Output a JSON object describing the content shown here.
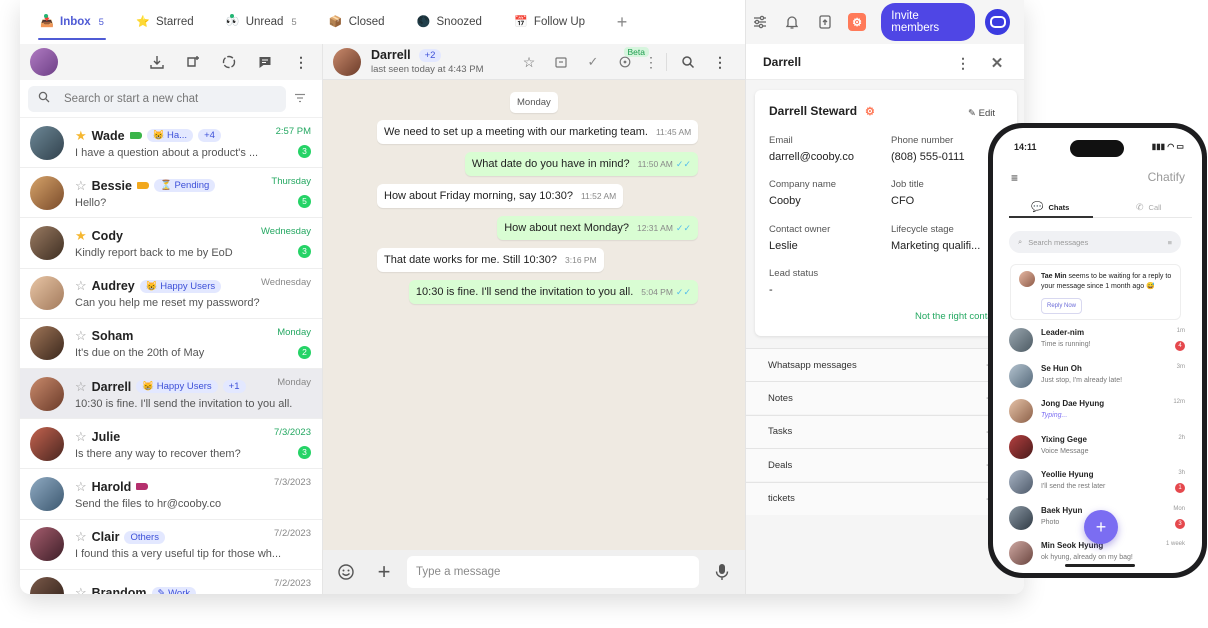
{
  "tabs": [
    {
      "label": "Inbox",
      "count": "5",
      "icon": "inbox-icon",
      "active": true,
      "dot": true
    },
    {
      "label": "Starred",
      "count": "",
      "icon": "star-icon",
      "active": false,
      "dot": false
    },
    {
      "label": "Unread",
      "count": "5",
      "icon": "eyes-icon",
      "active": false,
      "dot": true
    },
    {
      "label": "Closed",
      "count": "",
      "icon": "box-icon",
      "active": false,
      "dot": false
    },
    {
      "label": "Snoozed",
      "count": "",
      "icon": "moon-icon",
      "active": false,
      "dot": false
    },
    {
      "label": "Follow Up",
      "count": "",
      "icon": "calendar-icon",
      "active": false,
      "dot": false
    }
  ],
  "toolbar": {
    "invite_label": "Invite members"
  },
  "search": {
    "placeholder": "Search or start a new chat"
  },
  "chats": [
    {
      "name": "Wade",
      "starred": true,
      "tag_color": "#3ab54a",
      "label": "Ha...",
      "plus": "+4",
      "time": "2:57 PM",
      "time_green": true,
      "preview": "I have a question about a product's ...",
      "unread": "3",
      "av": [
        "#6d8796",
        "#31424d"
      ]
    },
    {
      "name": "Bessie",
      "starred": false,
      "tag_color": "#f2a81d",
      "label": "Pending",
      "plus": "",
      "time": "Thursday",
      "time_green": true,
      "preview": "Hello?",
      "unread": "5",
      "av": [
        "#d6a36a",
        "#7a4b2a"
      ]
    },
    {
      "name": "Cody",
      "starred": true,
      "tag_color": "",
      "label": "",
      "plus": "",
      "time": "Wednesday",
      "time_green": true,
      "preview": "Kindly report back to me by EoD",
      "unread": "3",
      "av": [
        "#9a7b62",
        "#3e2e22"
      ]
    },
    {
      "name": "Audrey",
      "starred": false,
      "tag_color": "",
      "label": "Happy Users",
      "plus": "",
      "time": "Wednesday",
      "time_green": false,
      "preview": "Can you help me reset my password?",
      "unread": "",
      "av": [
        "#e8c5a5",
        "#a27a5c"
      ]
    },
    {
      "name": "Soham",
      "starred": false,
      "tag_color": "",
      "label": "",
      "plus": "",
      "time": "Monday",
      "time_green": true,
      "preview": "It's due on the 20th of May",
      "unread": "2",
      "av": [
        "#a07658",
        "#3a271c"
      ]
    },
    {
      "name": "Darrell",
      "starred": false,
      "tag_color": "",
      "label": "Happy Users",
      "plus": "+1",
      "time": "Monday",
      "time_green": false,
      "preview": "10:30 is fine. I'll send the invitation to you all.",
      "unread": "",
      "av": [
        "#c98a6c",
        "#6b3b29"
      ],
      "selected": true
    },
    {
      "name": "Julie",
      "starred": false,
      "tag_color": "",
      "label": "",
      "plus": "",
      "time": "7/3/2023",
      "time_green": true,
      "preview": "Is there any way to recover them?",
      "unread": "3",
      "av": [
        "#c4634f",
        "#4a2620"
      ]
    },
    {
      "name": "Harold",
      "starred": false,
      "tag_color": "#b5306e",
      "label": "",
      "plus": "",
      "time": "7/3/2023",
      "time_green": false,
      "preview": "Send the files to hr@cooby.co",
      "unread": "",
      "av": [
        "#8faac2",
        "#3c5870"
      ]
    },
    {
      "name": "Clair",
      "starred": false,
      "tag_color": "",
      "label": "Others",
      "plus": "",
      "time": "7/2/2023",
      "time_green": false,
      "preview": "I found this a very useful tip for those wh...",
      "unread": "",
      "av": [
        "#a65d6e",
        "#3e1f28"
      ]
    },
    {
      "name": "Brandom",
      "starred": false,
      "tag_color": "",
      "label": "Work",
      "plus": "",
      "time": "7/2/2023",
      "time_green": false,
      "preview": "",
      "unread": "",
      "av": [
        "#7b5a4a",
        "#2c1d16"
      ]
    }
  ],
  "conversation": {
    "name": "Darrell",
    "plus": "+2",
    "status": "last seen today at 4:43 PM",
    "beta": "Beta",
    "day": "Monday",
    "messages": [
      {
        "dir": "in",
        "text": "We need to set up a meeting with our marketing team.",
        "time": "11:45 AM"
      },
      {
        "dir": "out",
        "text": "What date do you have in mind?",
        "time": "11:50 AM"
      },
      {
        "dir": "in",
        "text": "How about Friday morning, say 10:30?",
        "time": "11:52 AM"
      },
      {
        "dir": "out",
        "text": "How about next Monday?",
        "time": "12:31 AM"
      },
      {
        "dir": "in",
        "text": "That date works for me. Still 10:30?",
        "time": "3:16 PM"
      },
      {
        "dir": "out",
        "text": "10:30 is fine. I'll send the invitation to you all.",
        "time": "5:04 PM"
      }
    ],
    "composer_placeholder": "Type a message"
  },
  "contact": {
    "header": "Darrell",
    "name": "Darrell Steward",
    "edit": "Edit",
    "fields": [
      {
        "label": "Email",
        "value": "darrell@cooby.co"
      },
      {
        "label": "Phone number",
        "value": "(808) 555-0111"
      },
      {
        "label": "Company name",
        "value": "Cooby"
      },
      {
        "label": "Job title",
        "value": "CFO"
      },
      {
        "label": "Contact owner",
        "value": "Leslie"
      },
      {
        "label": "Lifecycle stage",
        "value": "Marketing qualifi..."
      },
      {
        "label": "Lead status",
        "value": "-"
      }
    ],
    "not_right": "Not the right conta",
    "sections": [
      "Whatsapp messages",
      "Notes",
      "Tasks",
      "Deals",
      "tickets"
    ]
  },
  "phone": {
    "time": "14:11",
    "brand": "Chatify",
    "tab_chats": "Chats",
    "tab_call": "Call",
    "search_placeholder": "Search messages",
    "note_name": "Tae Min",
    "note_text": " seems to be waiting for a reply to your message since 1 month ago",
    "note_button": "Reply Now",
    "chats": [
      {
        "name": "Leader-nim",
        "msg": "Time is running!",
        "time": "1m",
        "badge": "4",
        "av": [
          "#9aa7b0",
          "#4c5a63"
        ]
      },
      {
        "name": "Se Hun Oh",
        "msg": "Just stop, I'm already late!",
        "time": "3m",
        "badge": "",
        "av": [
          "#b4c3cf",
          "#55697a"
        ]
      },
      {
        "name": "Jong Dae Hyung",
        "msg": "Typing...",
        "time": "12m",
        "badge": "",
        "av": [
          "#e6c3a8",
          "#8c6048"
        ]
      },
      {
        "name": "Yixing Gege",
        "msg": "Voice Message",
        "time": "2h",
        "badge": "",
        "av": [
          "#b44040",
          "#4a1a1a"
        ]
      },
      {
        "name": "Yeollie Hyung",
        "msg": "I'll send the rest later",
        "time": "3h",
        "badge": "1",
        "av": [
          "#a8b4c4",
          "#4e5a6a"
        ]
      },
      {
        "name": "Baek Hyun",
        "msg": "Photo",
        "time": "Mon",
        "badge": "3",
        "av": [
          "#8a97a3",
          "#2f3a44"
        ]
      },
      {
        "name": "Min Seok Hyung",
        "msg": "ok hyung, already on my bag!",
        "time": "1 week",
        "badge": "",
        "av": [
          "#cfa8a2",
          "#6a4640"
        ]
      }
    ]
  }
}
